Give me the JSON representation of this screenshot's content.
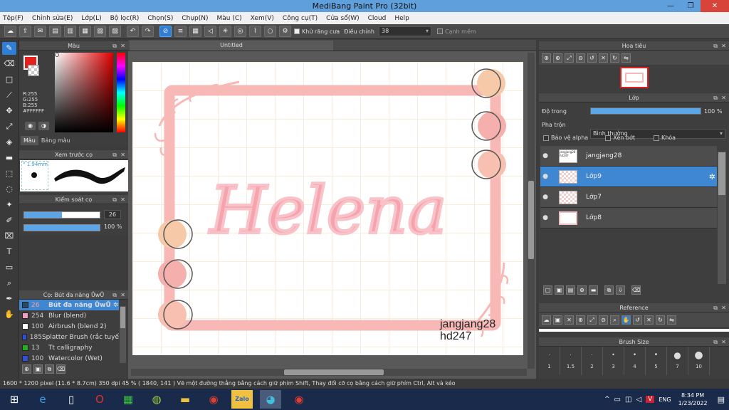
{
  "window": {
    "title": "MediBang Paint Pro (32bit)",
    "minimize": "—",
    "restore": "❐",
    "close": "✕"
  },
  "menu": [
    "Tệp(F)",
    "Chỉnh sửa(E)",
    "Lớp(L)",
    "Bộ lọc(R)",
    "Chọn(S)",
    "Chụp(N)",
    "Màu (C)",
    "Xem(V)",
    "Công cụ(T)",
    "Cửa sổ(W)",
    "Cloud",
    "Help"
  ],
  "toolbar": {
    "antialias_label": "Khử răng cưa",
    "correction_label": "Điều chỉnh",
    "correction_value": "38",
    "smooth_label": "Cạnh mềm"
  },
  "color_panel": {
    "title": "Màu",
    "r": "R:255",
    "g": "G:255",
    "b": "B:255",
    "hex": "#FFFFFF",
    "tab_color": "Màu",
    "tab_palette": "Bảng màu",
    "primary": "#e8201c"
  },
  "brush_preview": {
    "title": "Xem trước cọ",
    "size": "1.94mm"
  },
  "brush_control": {
    "title": "Kiểm soát cọ",
    "size_value": "26",
    "opacity_value": "100 %",
    "size_fraction": 0.5,
    "opacity_fraction": 1.0
  },
  "brush_list": {
    "title": "Cọ: Bút đa năng ŮwŮ",
    "items": [
      {
        "num": "26",
        "name": "Bút đa năng ŮwŮ",
        "color": "#2b4a66",
        "selected": true
      },
      {
        "num": "254",
        "name": "Blur (blend)",
        "color": "#f0a0c0",
        "selected": false
      },
      {
        "num": "100",
        "name": "Airbrush (blend 2)",
        "color": "#ffffff",
        "selected": false
      },
      {
        "num": "185",
        "name": "Splatter Brush (rắc tuyế",
        "color": "#3050d8",
        "selected": false
      },
      {
        "num": "13",
        "name": "Tt calligraphy",
        "color": "#20b020",
        "selected": false
      },
      {
        "num": "100",
        "name": "Watercolor (Wet)",
        "color": "#3050d8",
        "selected": false
      }
    ]
  },
  "canvas": {
    "tab": "Untitled",
    "artwork_text": "Helena",
    "signature_1": "jangjang28",
    "signature_2": "hd247"
  },
  "navigator": {
    "title": "Hoa tiêu"
  },
  "layers_panel": {
    "title": "Lớp",
    "opacity_label": "Độ trong",
    "opacity_value": "100 %",
    "opacity_fraction": 1.0,
    "blend_label": "Pha trộn",
    "blend_value": "Bình thường",
    "protect_alpha": "Bảo vệ alpha",
    "clipping": "Xén bớt",
    "lock": "Khóa",
    "layers": [
      {
        "name": "jangjang28",
        "thumb": "jangjang28 hd247",
        "selected": false
      },
      {
        "name": "Lớp9",
        "thumb": "",
        "selected": true
      },
      {
        "name": "Lớp7",
        "thumb": "",
        "selected": false
      },
      {
        "name": "Lớp8",
        "thumb": "",
        "selected": false
      }
    ]
  },
  "reference": {
    "title": "Reference"
  },
  "brush_size": {
    "title": "Brush Size",
    "sizes": [
      "1",
      "1.5",
      "2",
      "3",
      "4",
      "5",
      "7",
      "10"
    ]
  },
  "status": {
    "text": "1600 * 1200 pixel  (11.6 * 8.7cm)  350 dpi  45 %  ( 1840, 141 )  Vẽ một đường thẳng bằng cách giữ phím Shift, Thay đổi cỡ cọ bằng cách giữ phím Ctrl, Alt và kéo"
  },
  "taskbar": {
    "lang": "ENG",
    "time": "8:34 PM",
    "date": "1/23/2022",
    "zalo": "Zalo"
  }
}
